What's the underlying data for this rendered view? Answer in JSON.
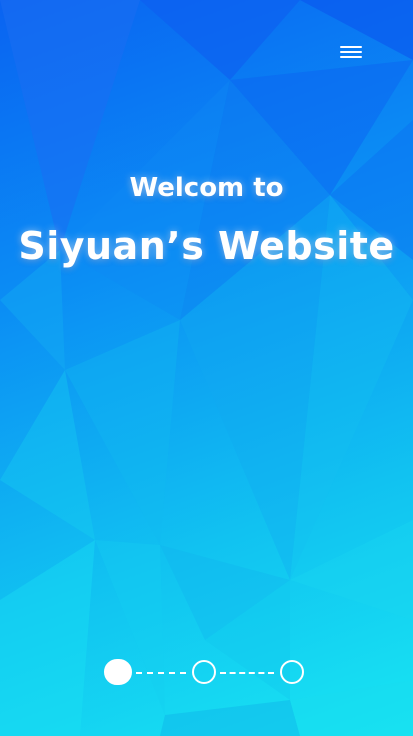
{
  "header": {
    "menu_icon": "hamburger-menu-icon"
  },
  "hero": {
    "line1": "Welcom to",
    "line2": "Siyuan’s Website"
  },
  "pager": {
    "dots": [
      "step-1",
      "step-2",
      "step-3"
    ],
    "active_index": 0
  },
  "colors": {
    "background_top": "#0a63f2",
    "background_bottom": "#18e6f2",
    "foreground": "#ffffff"
  }
}
